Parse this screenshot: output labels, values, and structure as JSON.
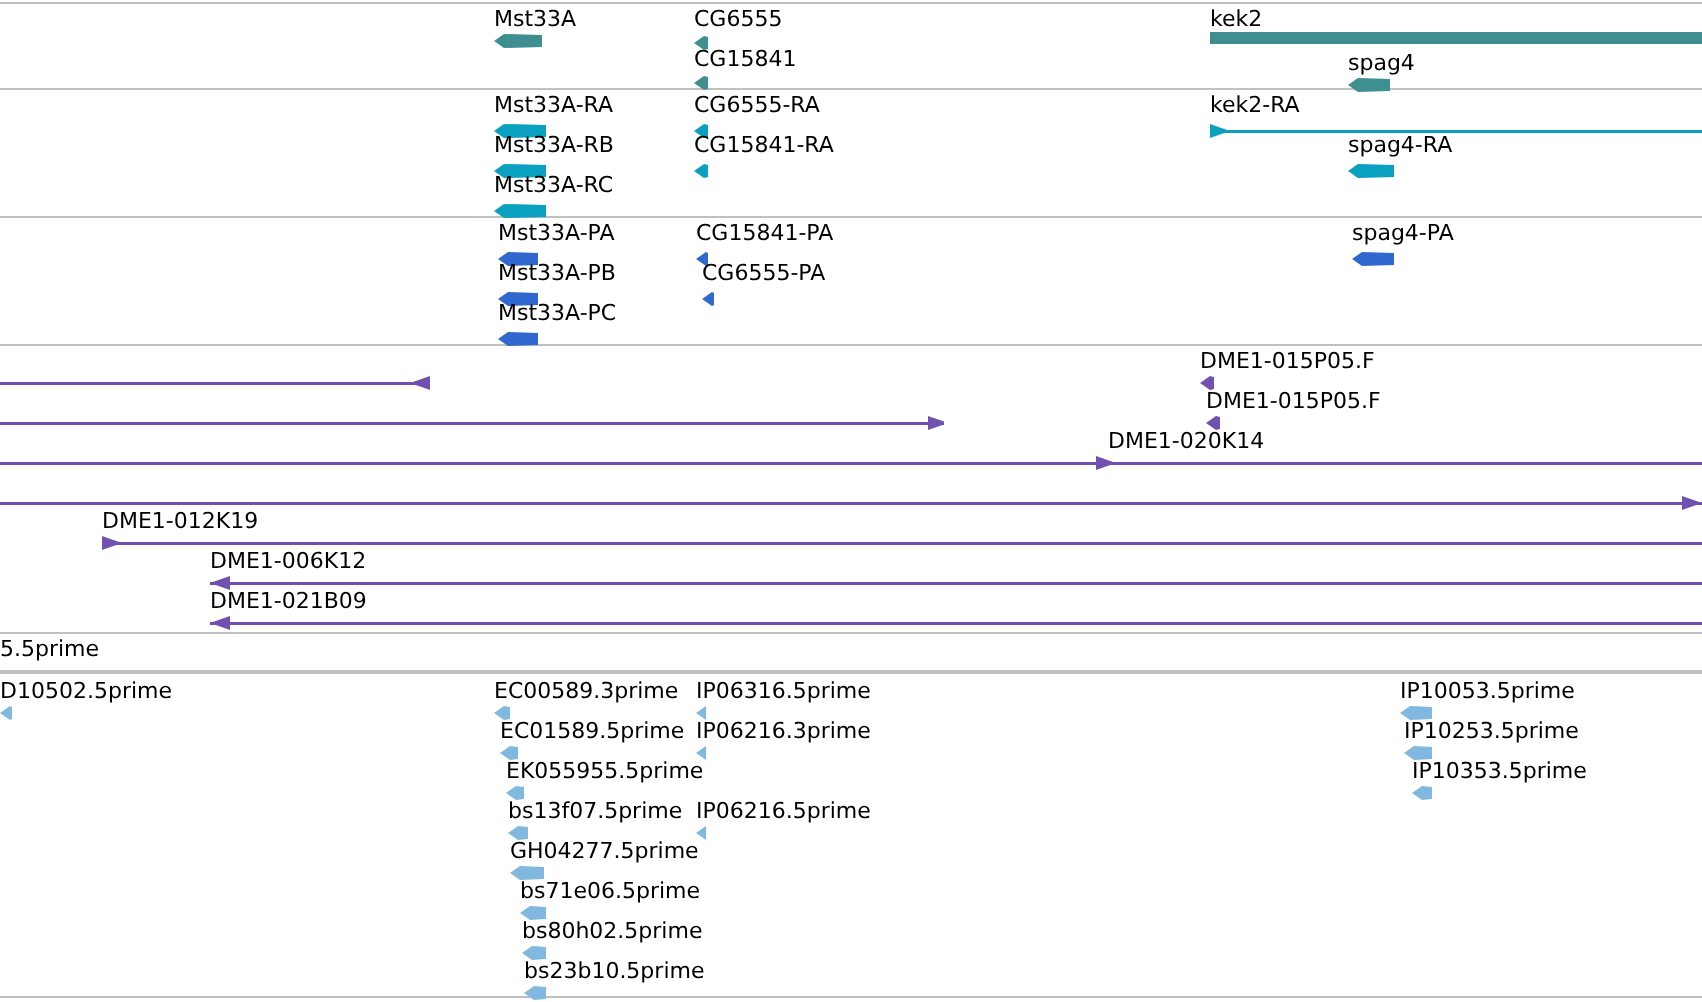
{
  "tracks": [
    {
      "color": "#3f8f90",
      "features": [
        {
          "label": "Mst33A",
          "reverse": true,
          "kind": "block"
        },
        {
          "label": "CG6555",
          "reverse": true,
          "kind": "block"
        },
        {
          "label": "CG15841",
          "reverse": true,
          "kind": "block"
        },
        {
          "label": "kek2",
          "reverse": false,
          "kind": "block"
        },
        {
          "label": "spag4",
          "reverse": true,
          "kind": "block"
        }
      ]
    },
    {
      "color": "#0aa0c0",
      "features": [
        {
          "label": "Mst33A-RA",
          "reverse": true,
          "kind": "block"
        },
        {
          "label": "Mst33A-RB",
          "reverse": true,
          "kind": "block"
        },
        {
          "label": "Mst33A-RC",
          "reverse": true,
          "kind": "block"
        },
        {
          "label": "CG6555-RA",
          "reverse": true,
          "kind": "block"
        },
        {
          "label": "CG15841-RA",
          "reverse": true,
          "kind": "block"
        },
        {
          "label": "kek2-RA",
          "reverse": false,
          "kind": "line"
        },
        {
          "label": "spag4-RA",
          "reverse": true,
          "kind": "block"
        }
      ]
    },
    {
      "color": "#3068d0",
      "features": [
        {
          "label": "Mst33A-PA",
          "reverse": true,
          "kind": "block"
        },
        {
          "label": "Mst33A-PB",
          "reverse": true,
          "kind": "block"
        },
        {
          "label": "Mst33A-PC",
          "reverse": true,
          "kind": "block"
        },
        {
          "label": "CG15841-PA",
          "reverse": true,
          "kind": "block"
        },
        {
          "label": "CG6555-PA",
          "reverse": true,
          "kind": "block"
        },
        {
          "label": "spag4-PA",
          "reverse": true,
          "kind": "block"
        }
      ]
    },
    {
      "color": "#7050b0",
      "features": [
        {
          "reverse": true,
          "kind": "line"
        },
        {
          "label": "DME1-015P05.F",
          "reverse": true,
          "kind": "block"
        },
        {
          "reverse": false,
          "kind": "line"
        },
        {
          "label": "DME1-015P05.F",
          "reverse": true,
          "kind": "block"
        },
        {
          "label": "DME1-020K14",
          "reverse": false,
          "kind": "line"
        },
        {
          "reverse": false,
          "kind": "line"
        },
        {
          "label": "DME1-012K19",
          "reverse": false,
          "kind": "line"
        },
        {
          "label": "DME1-006K12",
          "reverse": true,
          "kind": "line"
        },
        {
          "label": "DME1-021B09",
          "reverse": true,
          "kind": "line"
        }
      ]
    },
    {
      "features": [
        {
          "label": "5.5prime"
        }
      ]
    },
    {
      "color": "#80b8e0",
      "features": [
        {
          "label": "D10502.5prime",
          "reverse": true,
          "kind": "block"
        },
        {
          "label": "EC00589.3prime",
          "reverse": true,
          "kind": "block"
        },
        {
          "label": "IP06316.5prime",
          "reverse": true,
          "kind": "block"
        },
        {
          "label": "EC01589.5prime",
          "reverse": true,
          "kind": "block"
        },
        {
          "label": "IP06216.3prime",
          "reverse": true,
          "kind": "block"
        },
        {
          "label": "EK055955.5prime",
          "reverse": true,
          "kind": "block"
        },
        {
          "label": "bs13f07.5prime",
          "reverse": true,
          "kind": "block"
        },
        {
          "label": "IP06216.5prime",
          "reverse": true,
          "kind": "block"
        },
        {
          "label": "GH04277.5prime",
          "reverse": true,
          "kind": "block"
        },
        {
          "label": "bs71e06.5prime",
          "reverse": true,
          "kind": "block"
        },
        {
          "label": "bs80h02.5prime",
          "reverse": true,
          "kind": "block"
        },
        {
          "label": "bs23b10.5prime",
          "reverse": true,
          "kind": "block"
        },
        {
          "label": "IP10053.5prime",
          "reverse": true,
          "kind": "block"
        },
        {
          "label": "IP10253.5prime",
          "reverse": true,
          "kind": "block"
        },
        {
          "label": "IP10353.5prime",
          "reverse": true,
          "kind": "block"
        }
      ]
    }
  ]
}
